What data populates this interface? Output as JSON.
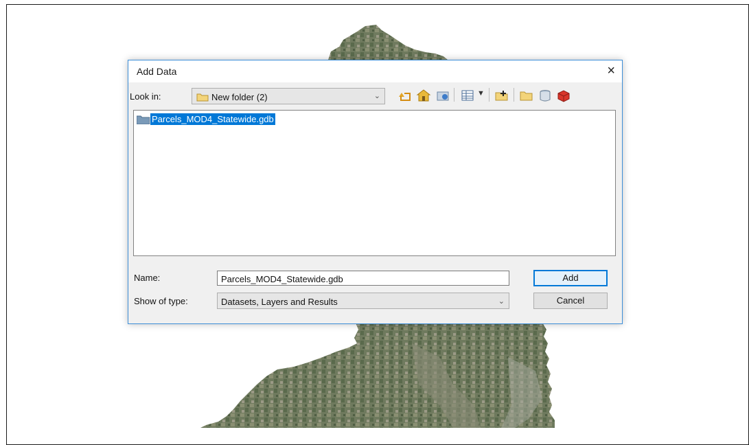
{
  "dialog": {
    "title": "Add Data",
    "close_symbol": "×",
    "look_in_label": "Look in:",
    "look_in_value": "New folder (2)",
    "toolbar_icons": [
      "up-one-level-icon",
      "home-icon",
      "connect-folder-icon",
      "view-options-icon",
      "new-folder-icon",
      "folder-icon",
      "database-icon",
      "toolbox-icon"
    ],
    "files": [
      {
        "name": "Parcels_MOD4_Statewide.gdb",
        "selected": true,
        "icon": "geodatabase-folder-icon"
      }
    ],
    "name_label": "Name:",
    "name_value": "Parcels_MOD4_Statewide.gdb",
    "type_label": "Show of type:",
    "type_value": "Datasets, Layers and Results",
    "add_label": "Add",
    "cancel_label": "Cancel"
  },
  "colors": {
    "accent": "#0078d7",
    "dialog_border": "#3c8ed8",
    "dialog_bg": "#f0f0f0"
  }
}
